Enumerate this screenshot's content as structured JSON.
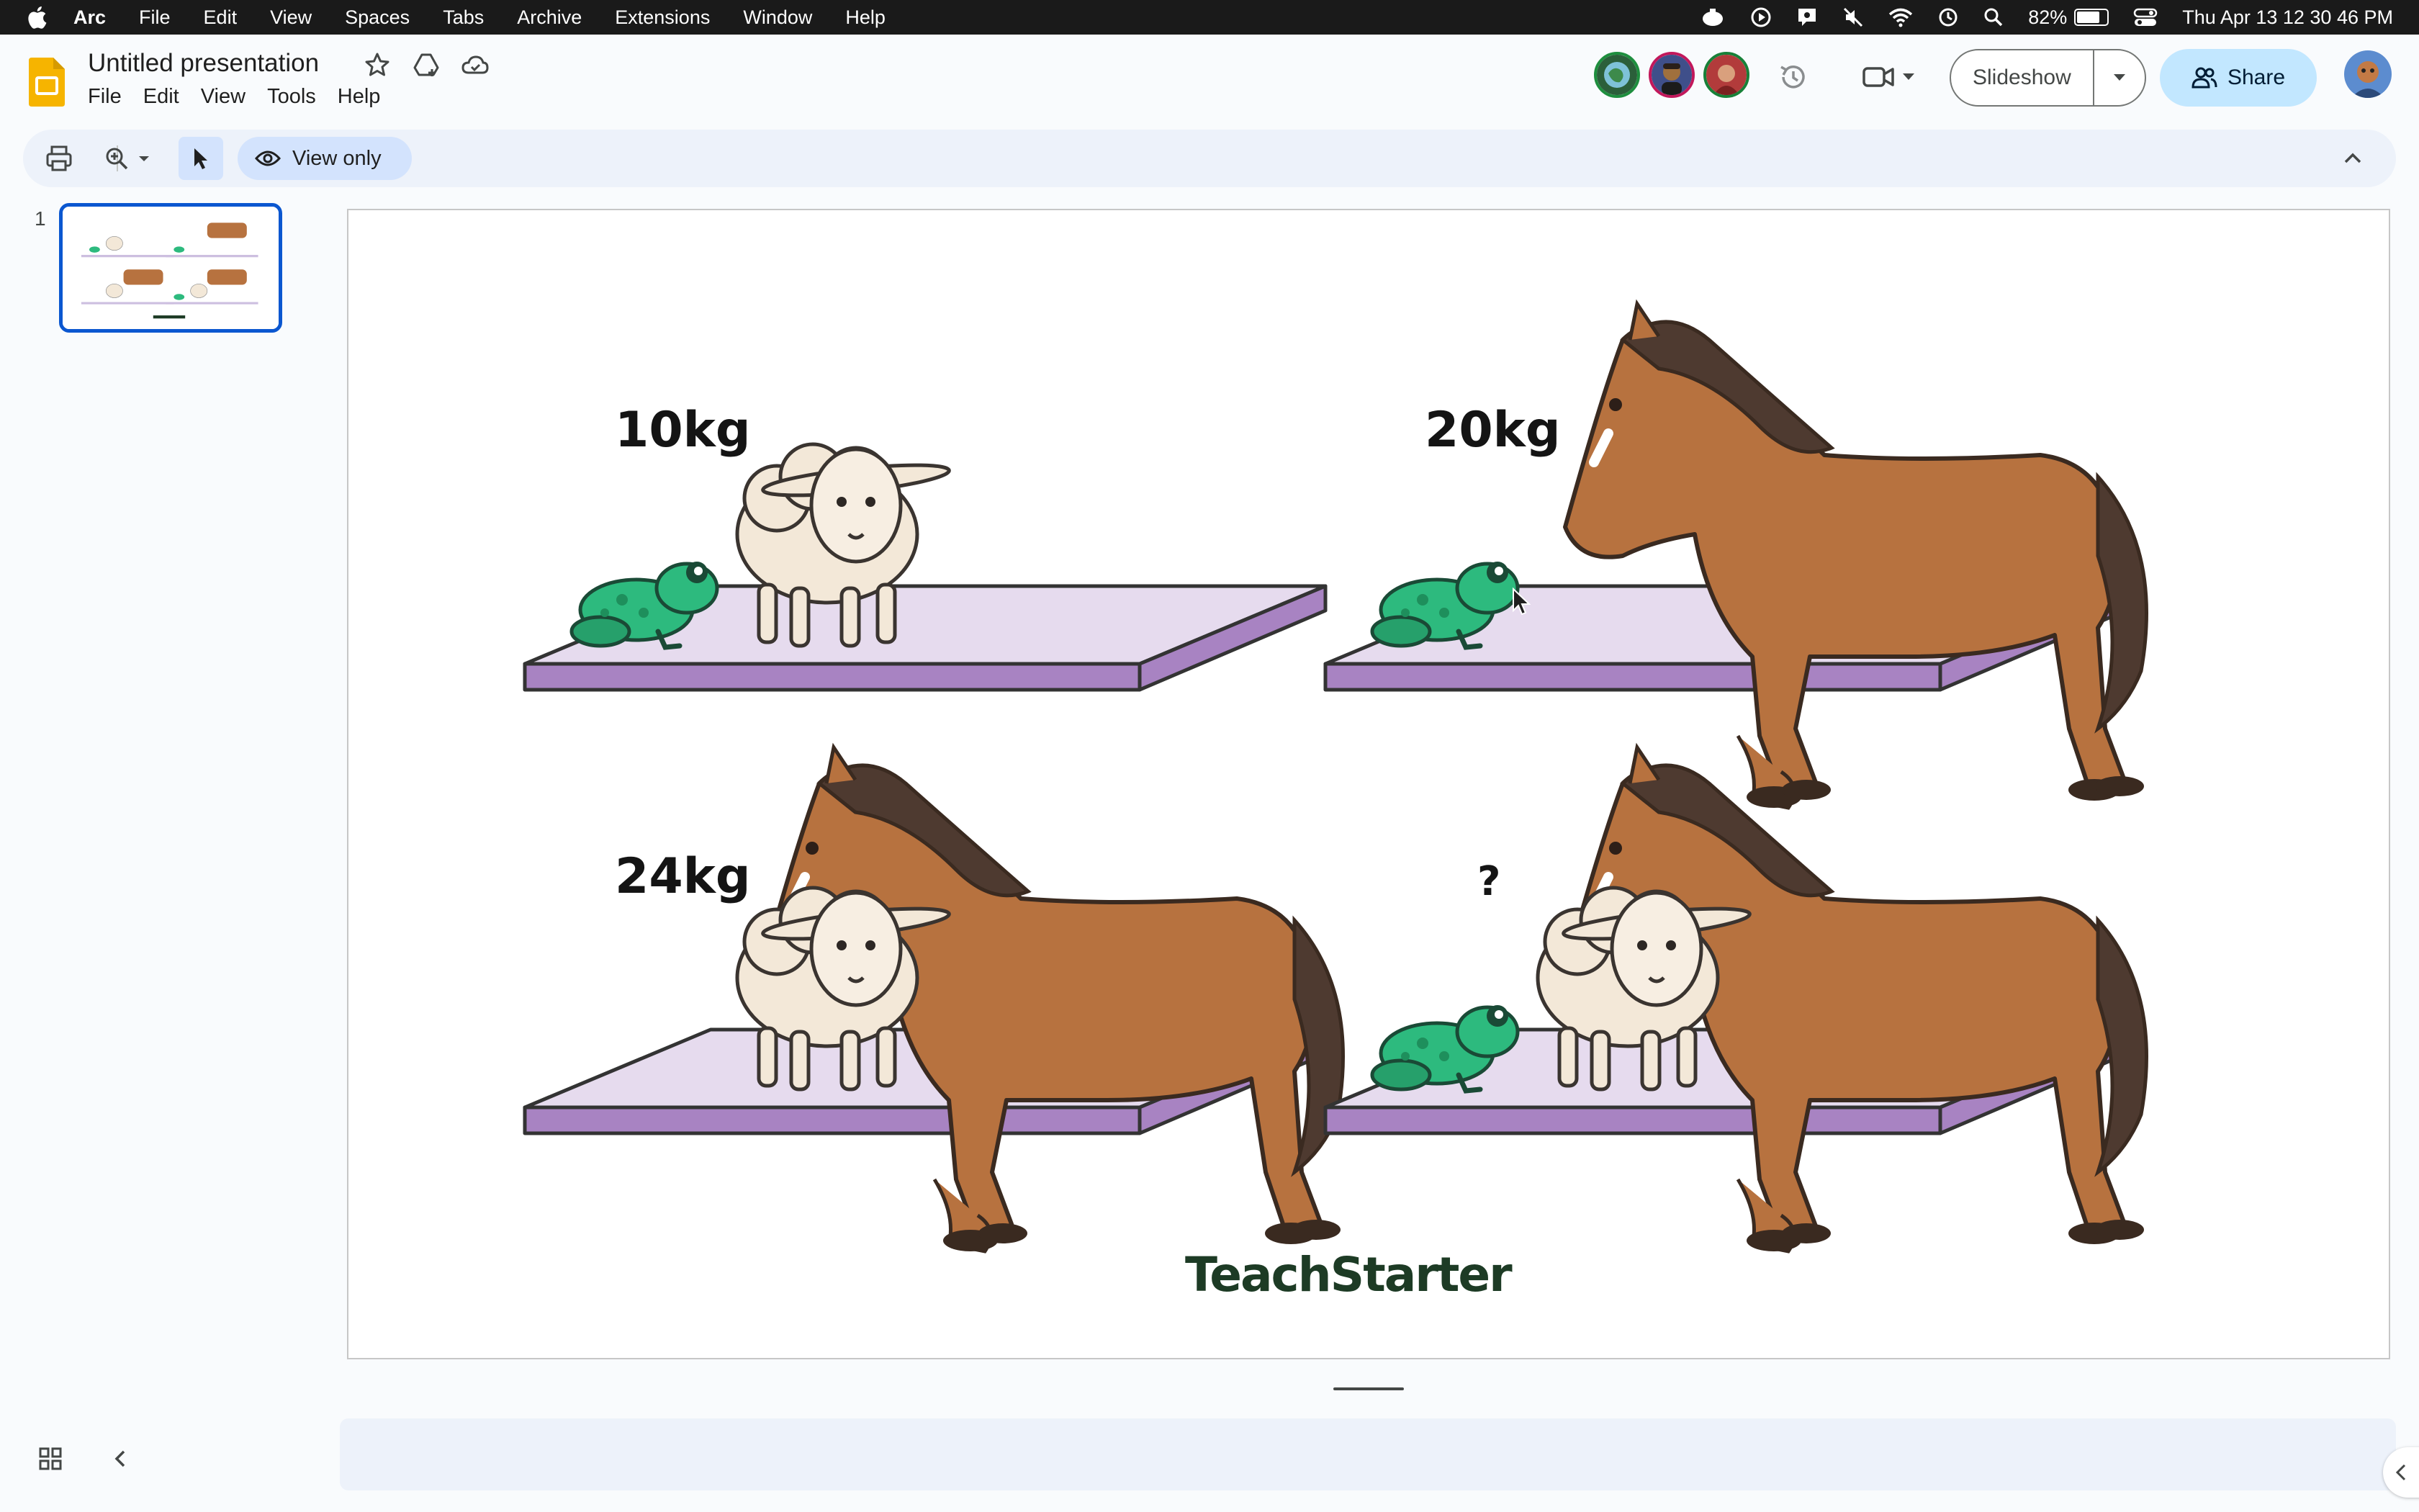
{
  "menubar": {
    "app": "Arc",
    "items": [
      "File",
      "Edit",
      "View",
      "Spaces",
      "Tabs",
      "Archive",
      "Extensions",
      "Window",
      "Help"
    ],
    "battery_percent": "82%",
    "battery_level": 0.82,
    "datetime": "Thu Apr 13  12 30 46 PM"
  },
  "header": {
    "title": "Untitled presentation",
    "menu": [
      "File",
      "Edit",
      "View",
      "Tools",
      "Help"
    ],
    "slideshow_label": "Slideshow",
    "share_label": "Share"
  },
  "toolbar": {
    "view_only_label": "View only"
  },
  "filmstrip": {
    "slide_number": "1"
  },
  "slide": {
    "panels": [
      {
        "label": "10kg",
        "animals": [
          "frog",
          "sheep"
        ]
      },
      {
        "label": "20kg",
        "animals": [
          "frog",
          "horse"
        ]
      },
      {
        "label": "24kg",
        "animals": [
          "sheep",
          "horse"
        ]
      },
      {
        "label": "?",
        "animals": [
          "frog",
          "sheep",
          "horse"
        ]
      }
    ],
    "logo": "TeachStarter"
  },
  "colors": {
    "accent": "#0b57d0",
    "share_bg": "#c2e7ff",
    "platform_top": "#e6dbee",
    "platform_side": "#a883c2",
    "horse": "#b7723f",
    "mane": "#4e3a30",
    "frog": "#2dba7e",
    "sheep": "#f3e8d8"
  }
}
